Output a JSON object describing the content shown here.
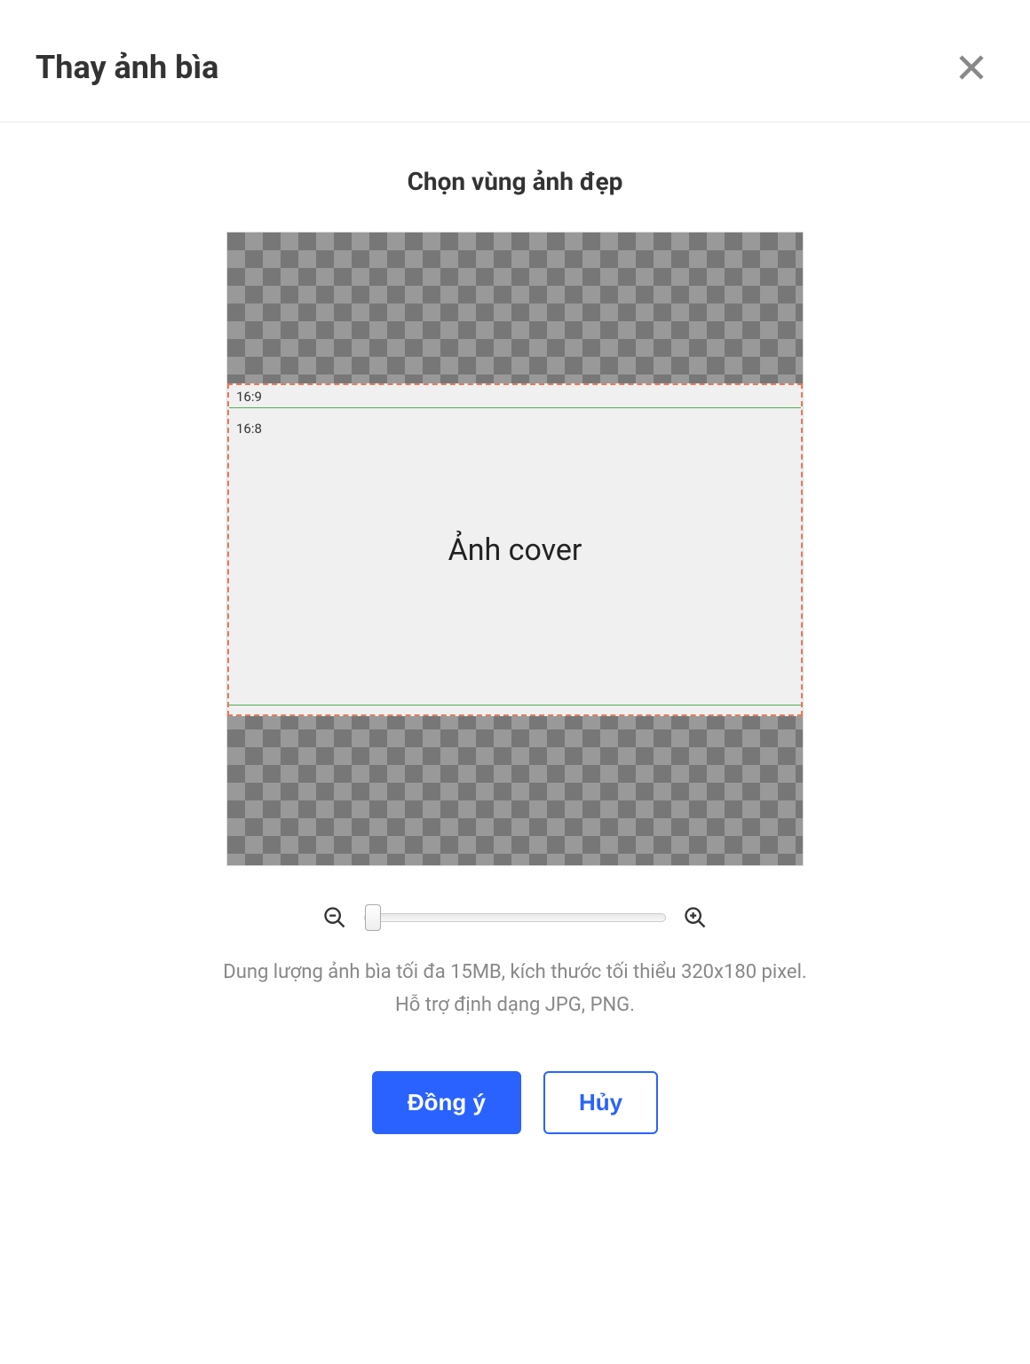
{
  "header": {
    "title": "Thay ảnh bìa"
  },
  "content": {
    "subtitle": "Chọn vùng ảnh đẹp",
    "ratio_labels": {
      "ratio_169": "16:9",
      "ratio_168": "16:8"
    },
    "cover_text": "Ảnh cover",
    "hint_line1": "Dung lượng ảnh bìa tối đa 15MB, kích thước tối thiểu 320x180 pixel.",
    "hint_line2": "Hỗ trợ định dạng JPG, PNG."
  },
  "zoom": {
    "value": 0,
    "min": 0,
    "max": 100
  },
  "buttons": {
    "ok": "Đồng ý",
    "cancel": "Hủy"
  }
}
